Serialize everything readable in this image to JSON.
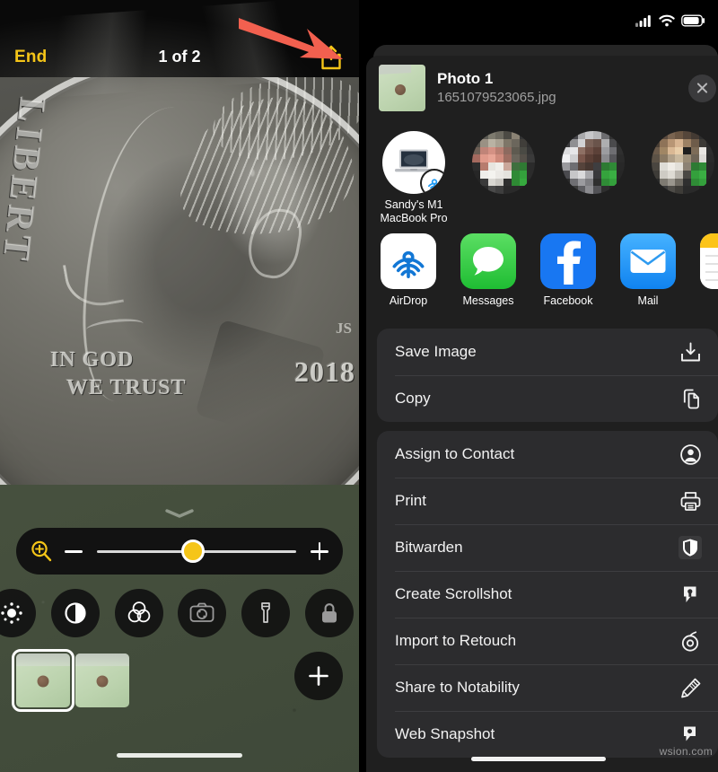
{
  "left_phone": {
    "app": "Magnifier",
    "topbar": {
      "end_label": "End",
      "page_indicator": "1 of 2",
      "share_icon": "share-up-arrow-icon"
    },
    "annotation": {
      "arrow": "red-arrow-pointing-to-share-button",
      "color": "#f2604f"
    },
    "magnified_subject": {
      "description": "US dime coin closeup",
      "liberty_text": "LIBERT",
      "motto_line1": "IN GOD",
      "motto_line2": "WE TRUST",
      "year": "2018",
      "mintmark": "JS"
    },
    "controls": {
      "zoom_icon": "magnifier-plus-icon",
      "minus_label": "minus-icon",
      "plus_label": "plus-icon",
      "slider_value_percent": 48,
      "accent_color": "#f5c518",
      "tools": [
        {
          "name": "brightness-icon"
        },
        {
          "name": "contrast-icon"
        },
        {
          "name": "color-filters-icon"
        },
        {
          "name": "camera-flip-icon"
        },
        {
          "name": "flashlight-icon"
        },
        {
          "name": "lock-icon"
        }
      ],
      "thumbnails": [
        {
          "selected": true
        },
        {
          "selected": false
        }
      ],
      "add_button": "plus-icon"
    }
  },
  "right_phone": {
    "statusbar": {
      "cellular": "cellular-signal-icon",
      "wifi": "wifi-icon",
      "battery": "battery-icon"
    },
    "share_sheet": {
      "title": "Photo 1",
      "subtitle": "1651079523065.jpg",
      "close": "close-icon",
      "airdrop_targets": [
        {
          "label": "Sandy's M1\nMacBook Pro",
          "type": "device",
          "badge": "airdrop-icon"
        },
        {
          "label": "",
          "type": "contact"
        },
        {
          "label": "",
          "type": "contact"
        },
        {
          "label": "",
          "type": "contact"
        },
        {
          "label": "",
          "type": "contact"
        }
      ],
      "apps": [
        {
          "label": "AirDrop",
          "icon": "airdrop-icon",
          "bg": "#ffffff"
        },
        {
          "label": "Messages",
          "icon": "messages-icon",
          "bg": "#3ad152"
        },
        {
          "label": "Facebook",
          "icon": "facebook-icon",
          "bg": "#1877f2"
        },
        {
          "label": "Mail",
          "icon": "mail-icon",
          "bg": "#1d9bf6"
        },
        {
          "label": "",
          "icon": "notes-icon",
          "bg": "#ffffff"
        }
      ],
      "menu_groups": [
        {
          "items": [
            {
              "label": "Save Image",
              "icon": "save-download-icon"
            },
            {
              "label": "Copy",
              "icon": "copy-icon"
            }
          ]
        },
        {
          "items": [
            {
              "label": "Assign to Contact",
              "icon": "contact-circle-icon"
            },
            {
              "label": "Print",
              "icon": "printer-icon"
            },
            {
              "label": "Bitwarden",
              "icon": "bitwarden-shield-icon"
            },
            {
              "label": "Create Scrollshot",
              "icon": "scrollshot-icon"
            },
            {
              "label": "Import to Retouch",
              "icon": "retouch-icon"
            },
            {
              "label": "Share to Notability",
              "icon": "pencil-icon"
            },
            {
              "label": "Web Snapshot",
              "icon": "web-snapshot-icon"
            }
          ]
        }
      ]
    },
    "watermark": "wsion.com"
  }
}
